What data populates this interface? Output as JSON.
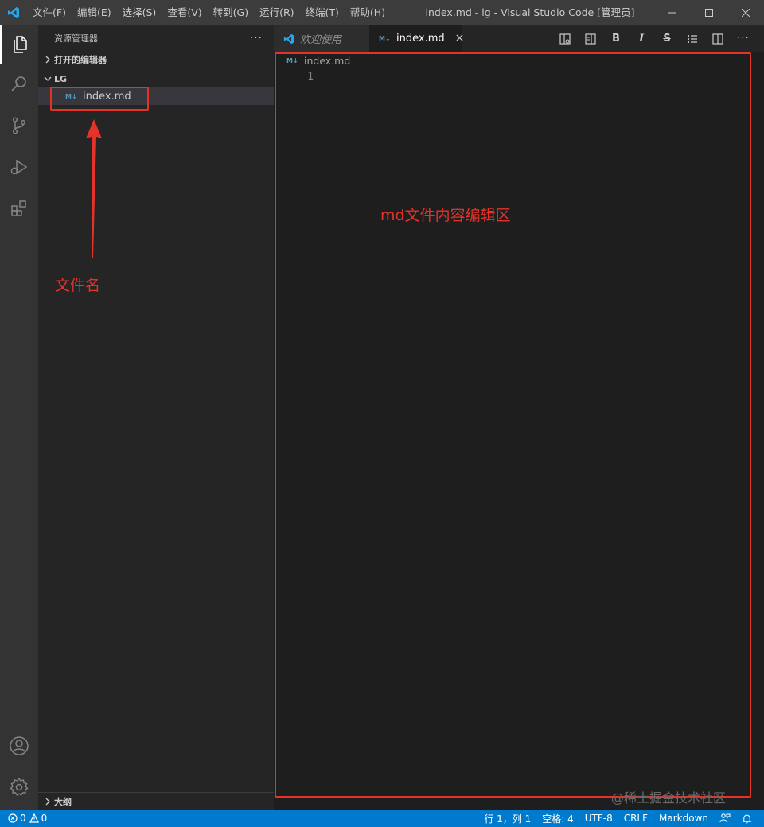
{
  "titlebar": {
    "menu": [
      "文件(F)",
      "编辑(E)",
      "选择(S)",
      "查看(V)",
      "转到(G)",
      "运行(R)",
      "终端(T)",
      "帮助(H)"
    ],
    "title": "index.md - lg - Visual Studio Code [管理员]"
  },
  "sidebar": {
    "header": "资源管理器",
    "more": "···",
    "open_editors": "打开的编辑器",
    "folder": "LG",
    "file": "index.md",
    "outline": "大纲"
  },
  "tabs": [
    {
      "label": "欢迎使用",
      "active": false
    },
    {
      "label": "index.md",
      "active": true
    }
  ],
  "editor": {
    "breadcrumb": "index.md",
    "line_number": "1",
    "md_badge": "M↓"
  },
  "annotations": {
    "file_label": "文件名",
    "content_label": "md文件内容编辑区",
    "color": "#e5332a"
  },
  "statusbar": {
    "errors": "0",
    "warnings": "0",
    "position": "行 1，列 1",
    "indent": "空格: 4",
    "encoding": "UTF-8",
    "eol": "CRLF",
    "language": "Markdown"
  },
  "watermark": "@稀土掘金技术社区",
  "colors": {
    "accent": "#007acc",
    "vscode_blue": "#23a9f2"
  }
}
